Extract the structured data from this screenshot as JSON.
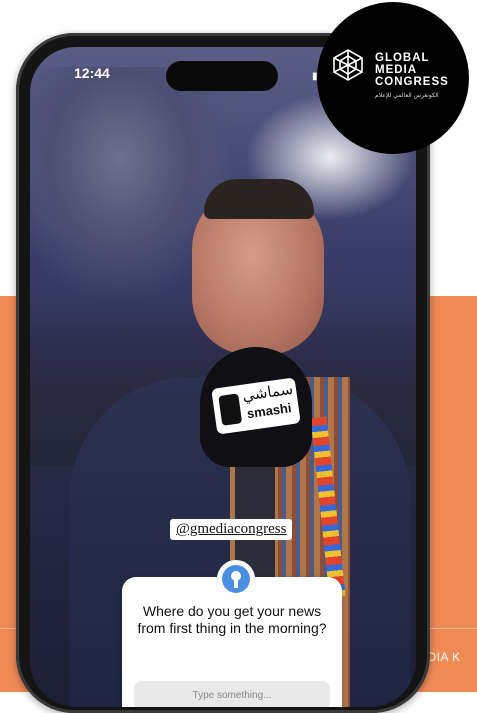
{
  "status_bar": {
    "time": "12:44"
  },
  "logo": {
    "line1": "GLOBAL",
    "line2": "MEDIA",
    "line3": "CONGRESS",
    "arabic": "الكونغرس العالمي للإعلام"
  },
  "microphone": {
    "arabic": "سماشي",
    "brand": "smashi"
  },
  "story": {
    "mention": "@gmediacongress",
    "question": "Where do you get your news from first thing in the morning?",
    "placeholder": "Type something..."
  },
  "footer": {
    "partial_text": "EDIA K"
  },
  "colors": {
    "accent": "#ef8a55",
    "question_avatar": "#4a8fe2"
  }
}
